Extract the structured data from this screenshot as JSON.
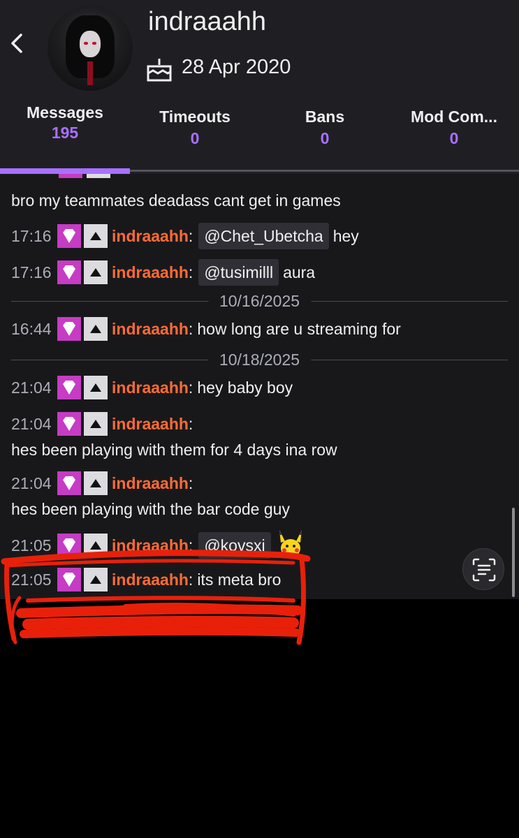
{
  "profile": {
    "username": "indraaahh",
    "join_date": "28 Apr 2020"
  },
  "tabs": [
    {
      "label": "Messages",
      "count": "195",
      "active": true
    },
    {
      "label": "Timeouts",
      "count": "0",
      "active": false
    },
    {
      "label": "Bans",
      "count": "0",
      "active": false
    },
    {
      "label": "Mod Com...",
      "count": "0",
      "active": false
    }
  ],
  "colors": {
    "accent": "#a970ff",
    "username": "#ff6b35",
    "sub_badge": "#c63cc4",
    "annotation": "#e8200a"
  },
  "icons": {
    "back": "chevron-left-icon",
    "cake": "cake-icon",
    "sub_badge": "diamond-icon",
    "arrow_badge": "triangle-up-icon",
    "scan": "text-scan-icon",
    "emote": "pikachu-emote"
  },
  "chat": {
    "partial_text": "bro my teammates deadass cant get in games",
    "messages": [
      {
        "time": "17:16",
        "user": "indraaahh",
        "sep": ":",
        "mention": "@Chet_Ubetcha",
        "text": "hey"
      },
      {
        "time": "17:16",
        "user": "indraaahh",
        "sep": ":",
        "mention": "@tusimilll",
        "text": "aura"
      },
      {
        "time": "16:44",
        "user": "indraaahh",
        "sep": ":",
        "text": "how long are u streaming for"
      },
      {
        "time": "21:04",
        "user": "indraaahh",
        "sep": ":",
        "text": "hey baby boy"
      },
      {
        "time": "21:04",
        "user": "indraaahh",
        "sep": ":",
        "text": "hes been playing with them for 4 days ina row"
      },
      {
        "time": "21:04",
        "user": "indraaahh",
        "sep": ":",
        "text": "hes been playing with the bar code guy"
      },
      {
        "time": "21:05",
        "user": "indraaahh",
        "sep": ":",
        "mention": "@kovsxi"
      },
      {
        "time": "21:05",
        "user": "indraaahh",
        "sep": ":",
        "text": "its meta bro"
      }
    ],
    "date_dividers": [
      "10/16/2025",
      "10/18/2025"
    ]
  }
}
